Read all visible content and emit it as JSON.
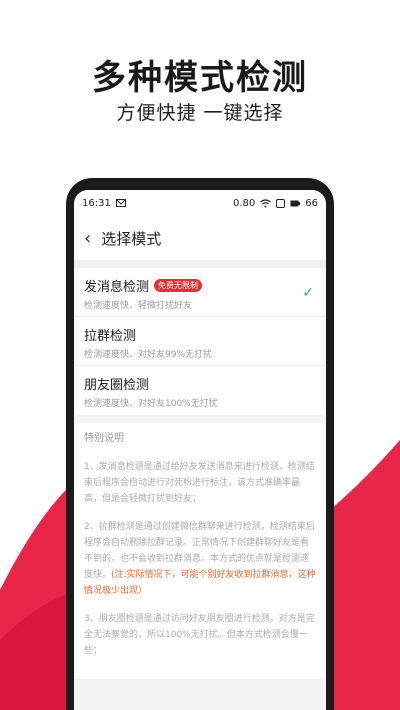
{
  "header": {
    "title": "多种模式检测",
    "subtitle": "方便快捷 一键选择"
  },
  "colors": {
    "accent": "#e0322f",
    "check": "#2bb34a",
    "warning": "#e8692b"
  },
  "status_bar": {
    "time": "16:31",
    "speed": "0.80",
    "battery": "66"
  },
  "nav": {
    "title": "选择模式"
  },
  "modes": [
    {
      "title": "发消息检测",
      "badge": "免费无限制",
      "subtitle": "检测速度快、轻微打扰好友",
      "selected": true
    },
    {
      "title": "拉群检测",
      "badge": "",
      "subtitle": "检测速度快、对好友99%无打扰",
      "selected": false
    },
    {
      "title": "朋友圈检测",
      "badge": "",
      "subtitle": "检测速度快、对好友100%无打扰",
      "selected": false
    }
  ],
  "notes": {
    "title": "特别说明",
    "p1": "1、发消息检测是通过给好友发送消息来进行检测，检测结束后程序会自动进行对死粉进行标注，该方式准确率最高，但是会轻微打扰到好友；",
    "p2": "2、拉群检测是通过创建微信群聊来进行检测，检测结束后程序会自动删除拉群记录。正常情况下创建群聊好友是看不到的，也不会收到拉群消息。本方式的优点就是检测速度快。",
    "p2_warning": "(注:实际情况下，可能个别好友收到拉群消息，这种情况极少出现）",
    "p3": "3、朋友圈检测是通过访问好友朋友圈进行检测，对方是完全无法察觉的，所以100%无打扰。但本方式检测会慢一些；"
  }
}
